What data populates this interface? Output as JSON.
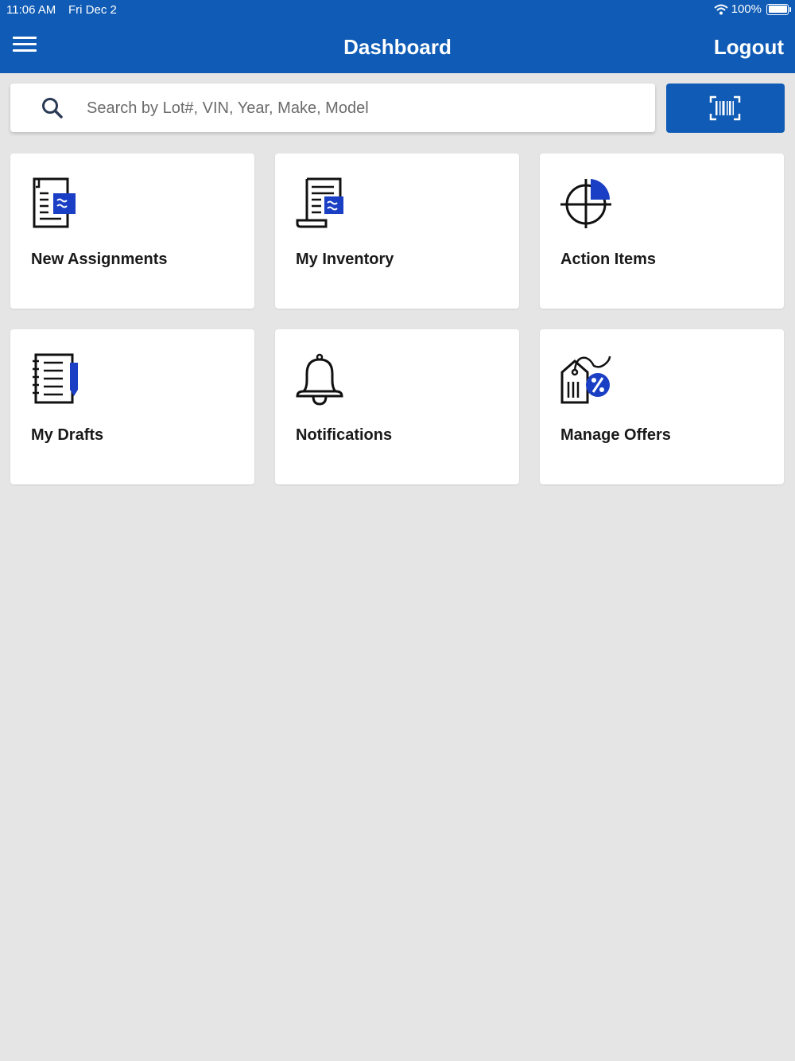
{
  "status_bar": {
    "time": "11:06 AM",
    "date": "Fri Dec 2",
    "battery": "100%"
  },
  "header": {
    "title": "Dashboard",
    "logout_label": "Logout"
  },
  "search": {
    "placeholder": "Search by Lot#, VIN, Year, Make, Model",
    "value": ""
  },
  "tiles": [
    {
      "label": "New Assignments",
      "icon": "document-assign-icon"
    },
    {
      "label": "My Inventory",
      "icon": "scroll-inventory-icon"
    },
    {
      "label": "Action Items",
      "icon": "target-chart-icon"
    },
    {
      "label": "My Drafts",
      "icon": "notebook-pen-icon"
    },
    {
      "label": "Notifications",
      "icon": "bell-icon"
    },
    {
      "label": "Manage Offers",
      "icon": "price-tag-percent-icon"
    }
  ],
  "colors": {
    "brand_blue": "#0f5bb5",
    "accent_blue": "#1a3fc4",
    "background": "#e5e5e5"
  }
}
